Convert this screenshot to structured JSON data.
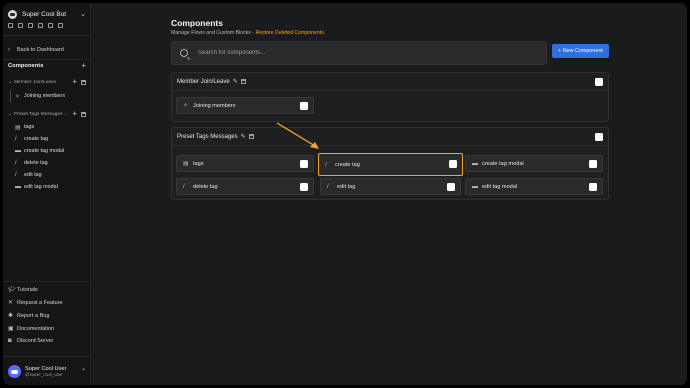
{
  "sidebar": {
    "bot_name": "Super Cool Bot",
    "back": "Back to Dashboard",
    "components_title": "Components",
    "folders": [
      {
        "name": "Member Join/Leave",
        "items": [
          {
            "icon": "sparkle-icon",
            "label": "Joining members"
          }
        ]
      },
      {
        "name": "Preset Tags Messages ...",
        "items": [
          {
            "icon": "message-icon",
            "label": "tags"
          },
          {
            "icon": "slash-icon",
            "label": "create tag"
          },
          {
            "icon": "modal-icon",
            "label": "create tag modal"
          },
          {
            "icon": "slash-icon",
            "label": "delete tag"
          },
          {
            "icon": "slash-icon",
            "label": "edit tag"
          },
          {
            "icon": "modal-icon",
            "label": "edit tag modal"
          }
        ]
      }
    ],
    "bottom_links": [
      "Tutorials",
      "Request a Feature",
      "Report a Bug",
      "Documentation",
      "Discord Server"
    ],
    "user": {
      "name": "Super Cool User",
      "handle": "@super_cool_user"
    }
  },
  "main": {
    "title": "Components",
    "subtitle": "Manage Flows and Custom Blocks - ",
    "restore_link": "Restore Deleted Components",
    "search_placeholder": "Search for components...",
    "new_button": "+ New Component",
    "groups": [
      {
        "name": "Member Join/Leave",
        "cards": [
          {
            "icon": "sparkle-icon",
            "label": "Joining members"
          }
        ]
      },
      {
        "name": "Preset Tags Messages",
        "cards": [
          {
            "icon": "message-icon",
            "label": "tags"
          },
          {
            "icon": "slash-icon",
            "label": "create tag",
            "highlighted": true
          },
          {
            "icon": "modal-icon",
            "label": "create tag modal"
          },
          {
            "icon": "slash-icon",
            "label": "delete tag"
          },
          {
            "icon": "slash-icon",
            "label": "edit tag"
          },
          {
            "icon": "modal-icon",
            "label": "edit tag modal"
          }
        ]
      }
    ]
  },
  "colors": {
    "accent_orange": "#f5a623",
    "primary_blue": "#2f6fe0"
  }
}
